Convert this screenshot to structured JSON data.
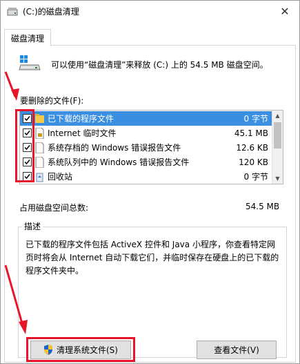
{
  "window": {
    "title": "(C:)的磁盘清理",
    "close_glyph": "✕"
  },
  "tab": {
    "label": "磁盘清理"
  },
  "intro": {
    "text": "可以使用“磁盘清理”来释放 (C:) 上的 54.5 MB 磁盘空间。"
  },
  "files": {
    "label": "要删除的文件(F):",
    "items": [
      {
        "name": "已下载的程序文件",
        "size": "0 字节",
        "checked": true,
        "selected": true,
        "icon": "folder-icon"
      },
      {
        "name": "Internet 临时文件",
        "size": "45.1 MB",
        "checked": true,
        "selected": false,
        "icon": "lock-file-icon"
      },
      {
        "name": "系统存档的 Windows 错误报告文件",
        "size": "12.6 KB",
        "checked": true,
        "selected": false,
        "icon": "document-icon"
      },
      {
        "name": "系统队列中的 Windows 错误报告文件",
        "size": "120 KB",
        "checked": true,
        "selected": false,
        "icon": "document-icon"
      },
      {
        "name": "回收站",
        "size": "0 字节",
        "checked": true,
        "selected": false,
        "icon": "recycle-bin-icon"
      }
    ]
  },
  "total": {
    "label": "占用磁盘空间总数:",
    "value": "54.5 MB"
  },
  "description": {
    "title": "描述",
    "text": "已下载的程序文件包括 ActiveX 控件和 Java 小程序，你查看特定网页时将会从 Internet 自动下载它们，并临时保存在硬盘上的已下载的程序文件夹中。"
  },
  "buttons": {
    "clean_system": "清理系统文件(S)",
    "view_files": "查看文件(V)"
  },
  "colors": {
    "selection": "#3b8fe0",
    "highlight_red": "#e8142a"
  }
}
